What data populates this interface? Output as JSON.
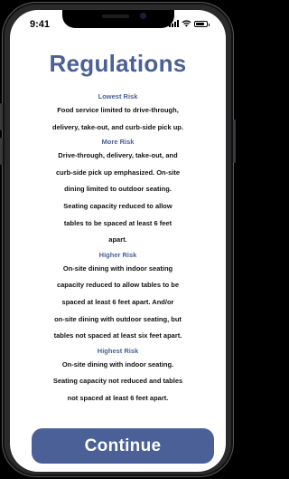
{
  "status_bar": {
    "time": "9:41",
    "battery_level": 0.85
  },
  "title": "Regulations",
  "sections": [
    {
      "heading": "Lowest Risk",
      "lines": [
        "Food service limited to drive-through,",
        "delivery, take-out, and curb-side pick up."
      ]
    },
    {
      "heading": "More Risk",
      "lines": [
        "Drive-through, delivery, take-out, and",
        "curb-side pick up emphasized. On-site",
        "dining limited to outdoor seating.",
        "Seating capacity reduced to allow",
        "tables to be spaced at least 6 feet",
        "apart."
      ]
    },
    {
      "heading": "Higher Risk",
      "lines": [
        "On-site dining with indoor seating",
        "capacity reduced to allow tables to be",
        "spaced at least 6 feet apart. And/or",
        "on-site dining with outdoor seating, but",
        "tables not spaced at least six feet apart."
      ]
    },
    {
      "heading": "Highest Risk",
      "lines": [
        "On-site dining with indoor seating.",
        "Seating capacity not reduced and tables",
        "not spaced at least 6 feet apart."
      ]
    }
  ],
  "continue_label": "Continue",
  "colors": {
    "accent": "#4a6096",
    "text": "#111111",
    "background": "#ffffff"
  }
}
